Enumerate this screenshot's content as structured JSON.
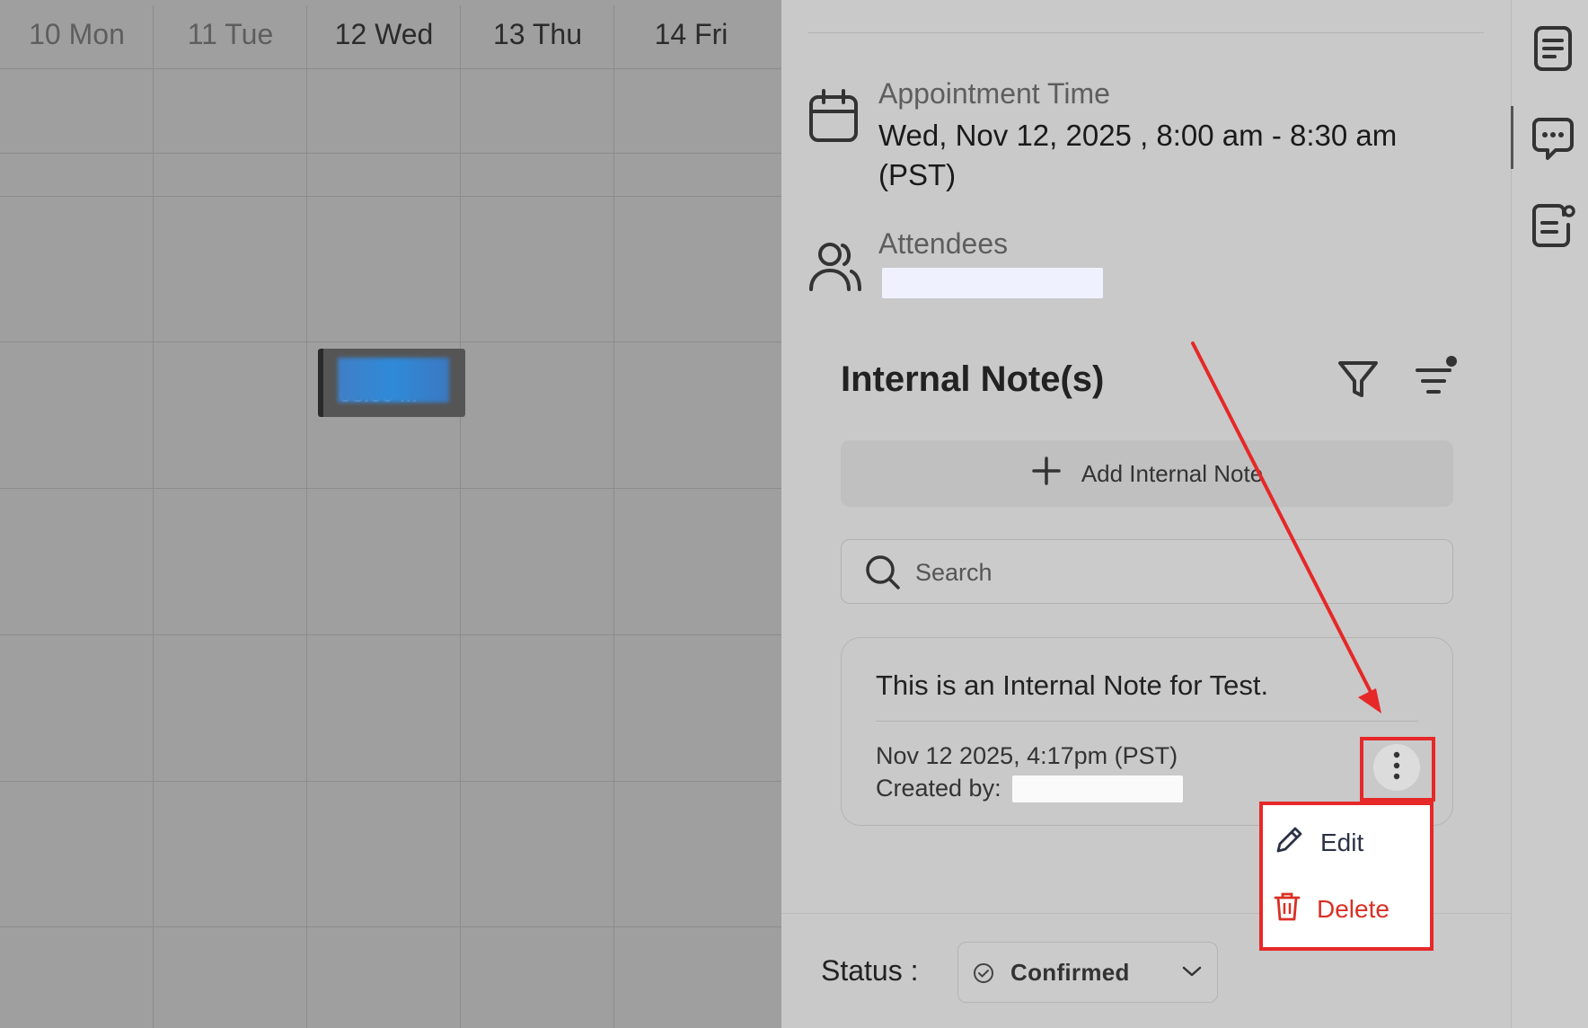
{
  "calendar": {
    "days": [
      {
        "label": "10 Mon",
        "past": true
      },
      {
        "label": "11 Tue",
        "past": true
      },
      {
        "label": "12 Wed",
        "past": false
      },
      {
        "label": "13 Thu",
        "past": false
      },
      {
        "label": "14 Fri",
        "past": false
      }
    ],
    "event_time": "08:00 ..."
  },
  "panel": {
    "appointment_label": "Appointment Time",
    "appointment_value_line1": "Wed, Nov 12, 2025 , 8:00 am - 8:30 am",
    "appointment_value_line2": "(PST)",
    "attendees_label": "Attendees",
    "notes_title": "Internal Note(s)",
    "add_note_label": "Add Internal Note",
    "search_placeholder": "Search",
    "note": {
      "text": "This is an Internal Note for Test.",
      "timestamp": "Nov 12 2025, 4:17pm (PST)",
      "created_by_label": "Created by:"
    },
    "menu": {
      "edit_label": "Edit",
      "delete_label": "Delete"
    },
    "status_label": "Status :",
    "status_value": "Confirmed"
  },
  "colors": {
    "annotation": "#e62828",
    "delete": "#d93025",
    "overlay_dim": "#9e9e9e"
  },
  "icons": {
    "calendar": "calendar-icon",
    "attendees": "users-icon",
    "filter": "filter-icon",
    "sort": "sort-lines-icon",
    "add": "plus-icon",
    "search": "search-icon",
    "more": "vertical-dots-icon",
    "edit": "pencil-icon",
    "delete": "trash-icon",
    "status": "check-circle-icon",
    "chevron": "chevron-down-icon",
    "rail": [
      "document-icon",
      "chat-icon",
      "notes-icon"
    ]
  }
}
